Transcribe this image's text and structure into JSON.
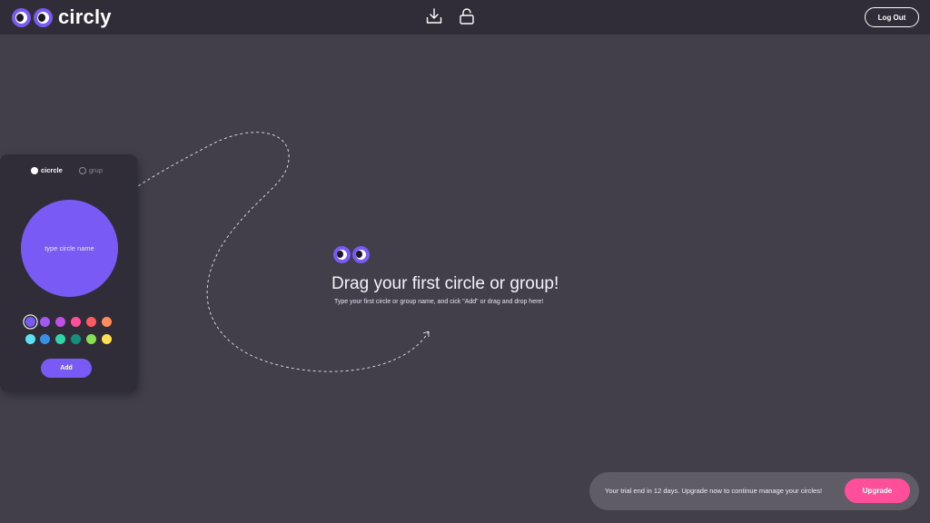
{
  "app": {
    "logo_text": "circly",
    "brand_color": "#7a5af5",
    "accent_color": "#ff4f9a"
  },
  "toolbar": {
    "icons": [
      "download-icon",
      "unlock-icon"
    ],
    "logout_label": "Log Out"
  },
  "creator": {
    "options": [
      {
        "label": "cicrcle",
        "selected": true
      },
      {
        "label": "grup",
        "selected": false
      }
    ],
    "name_placeholder": "type circle name",
    "selected_color": "#7a5af5",
    "colors": [
      "#7a5af5",
      "#a259f0",
      "#c04fe6",
      "#ff4f9a",
      "#ff5a5f",
      "#ff8c5a",
      "#5fe0f0",
      "#3a8fe8",
      "#2fd6a8",
      "#14917a",
      "#86e04f",
      "#ffe04f"
    ],
    "add_label": "Add"
  },
  "empty_state": {
    "title": "Drag your first circle or group!",
    "subtitle": "Type your first circle or group name, and cick \"Add\" or drag and drop here!"
  },
  "trial": {
    "message": "Your trial end in 12 days. Upgrade now to continue manage your circles!",
    "upgrade_label": "Upgrade"
  }
}
